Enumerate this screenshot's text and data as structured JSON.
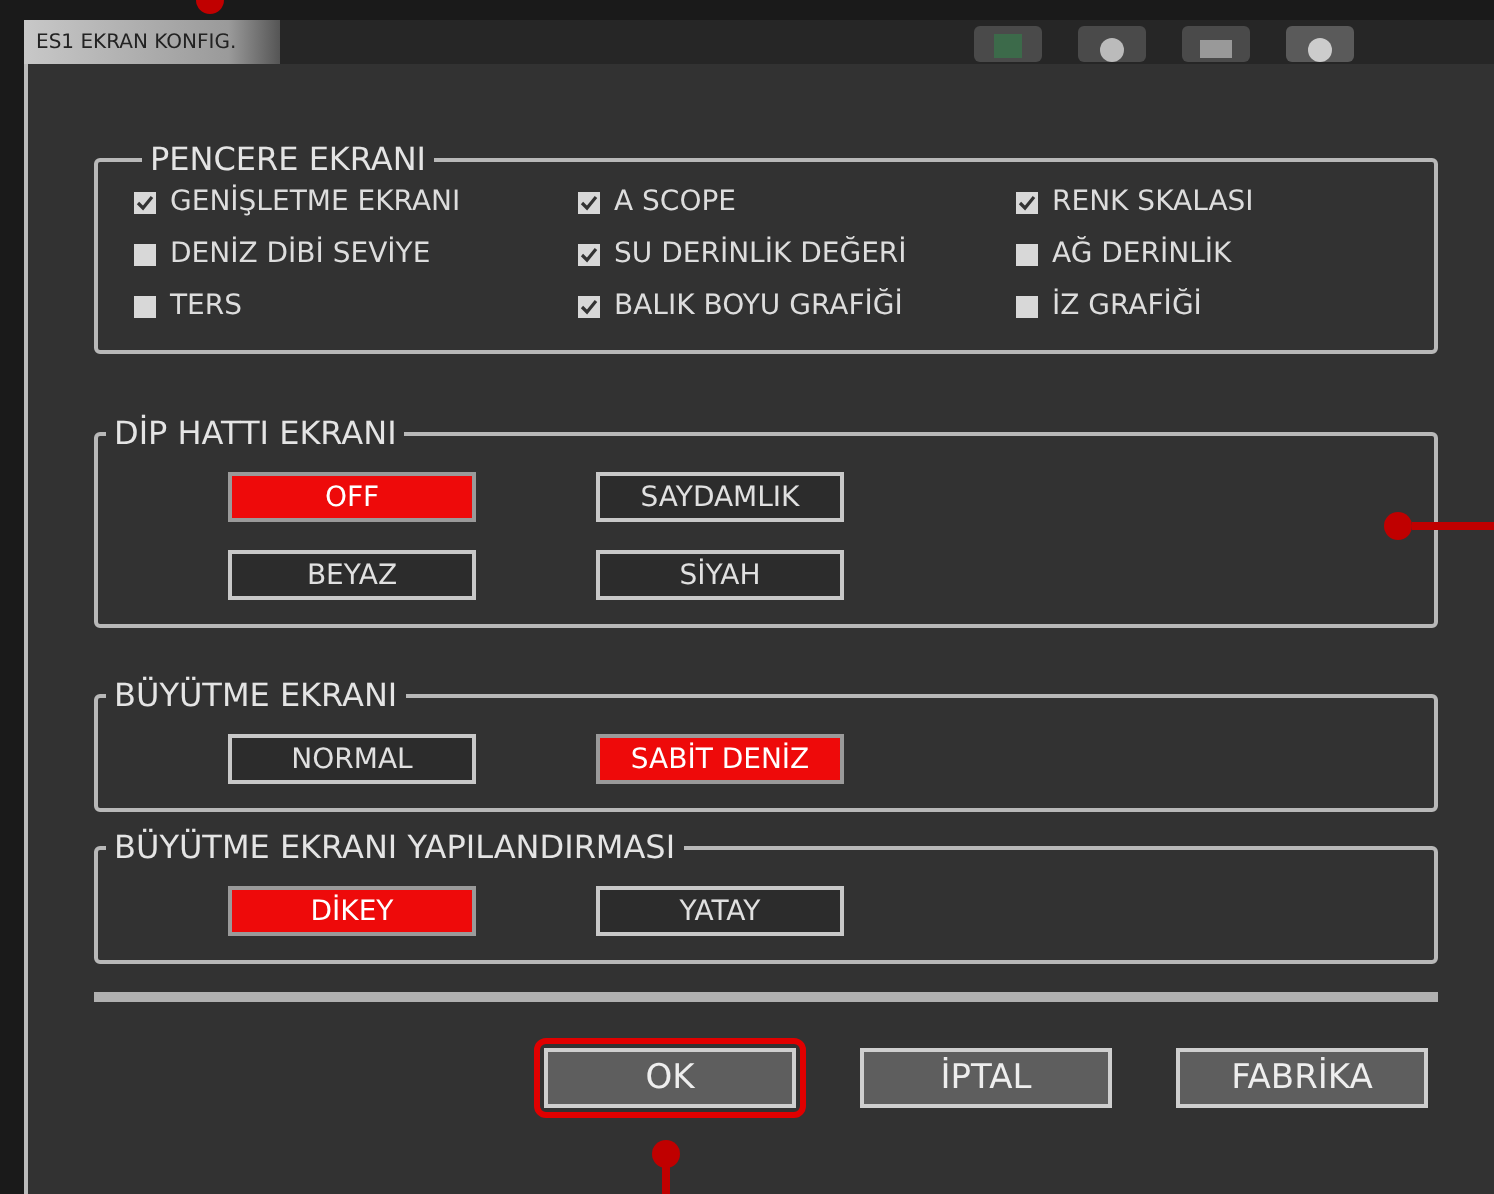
{
  "window": {
    "title": "ES1 EKRAN KONFIG."
  },
  "groups": [
    {
      "title": "PENCERE EKRANI",
      "kind": "checkboxes",
      "items": [
        {
          "label": "GENİŞLETME EKRANI",
          "checked": true
        },
        {
          "label": "A SCOPE",
          "checked": true
        },
        {
          "label": "RENK SKALASI",
          "checked": true
        },
        {
          "label": "DENİZ DİBİ SEVİYE",
          "checked": false
        },
        {
          "label": "SU DERİNLİK DEĞERİ",
          "checked": true
        },
        {
          "label": "AĞ DERİNLİK",
          "checked": false
        },
        {
          "label": "TERS",
          "checked": false
        },
        {
          "label": "BALIK BOYU GRAFİĞİ",
          "checked": true
        },
        {
          "label": "İZ GRAFİĞİ",
          "checked": false
        }
      ]
    },
    {
      "title": "DİP HATTI EKRANI",
      "kind": "options",
      "items": [
        {
          "label": "OFF",
          "selected": true
        },
        {
          "label": "SAYDAMLIK",
          "selected": false
        },
        {
          "label": "BEYAZ",
          "selected": false
        },
        {
          "label": "SİYAH",
          "selected": false
        }
      ]
    },
    {
      "title": "BÜYÜTME EKRANI",
      "kind": "options",
      "items": [
        {
          "label": "NORMAL",
          "selected": false
        },
        {
          "label": "SABİT DENİZ",
          "selected": true
        }
      ]
    },
    {
      "title": "BÜYÜTME EKRANI YAPILANDIRMASI",
      "kind": "options",
      "items": [
        {
          "label": "DİKEY",
          "selected": true
        },
        {
          "label": "YATAY",
          "selected": false
        }
      ]
    }
  ],
  "buttons": [
    {
      "label": "OK",
      "highlighted": true
    },
    {
      "label": "İPTAL",
      "highlighted": false
    },
    {
      "label": "FABRİKA",
      "highlighted": false
    }
  ]
}
